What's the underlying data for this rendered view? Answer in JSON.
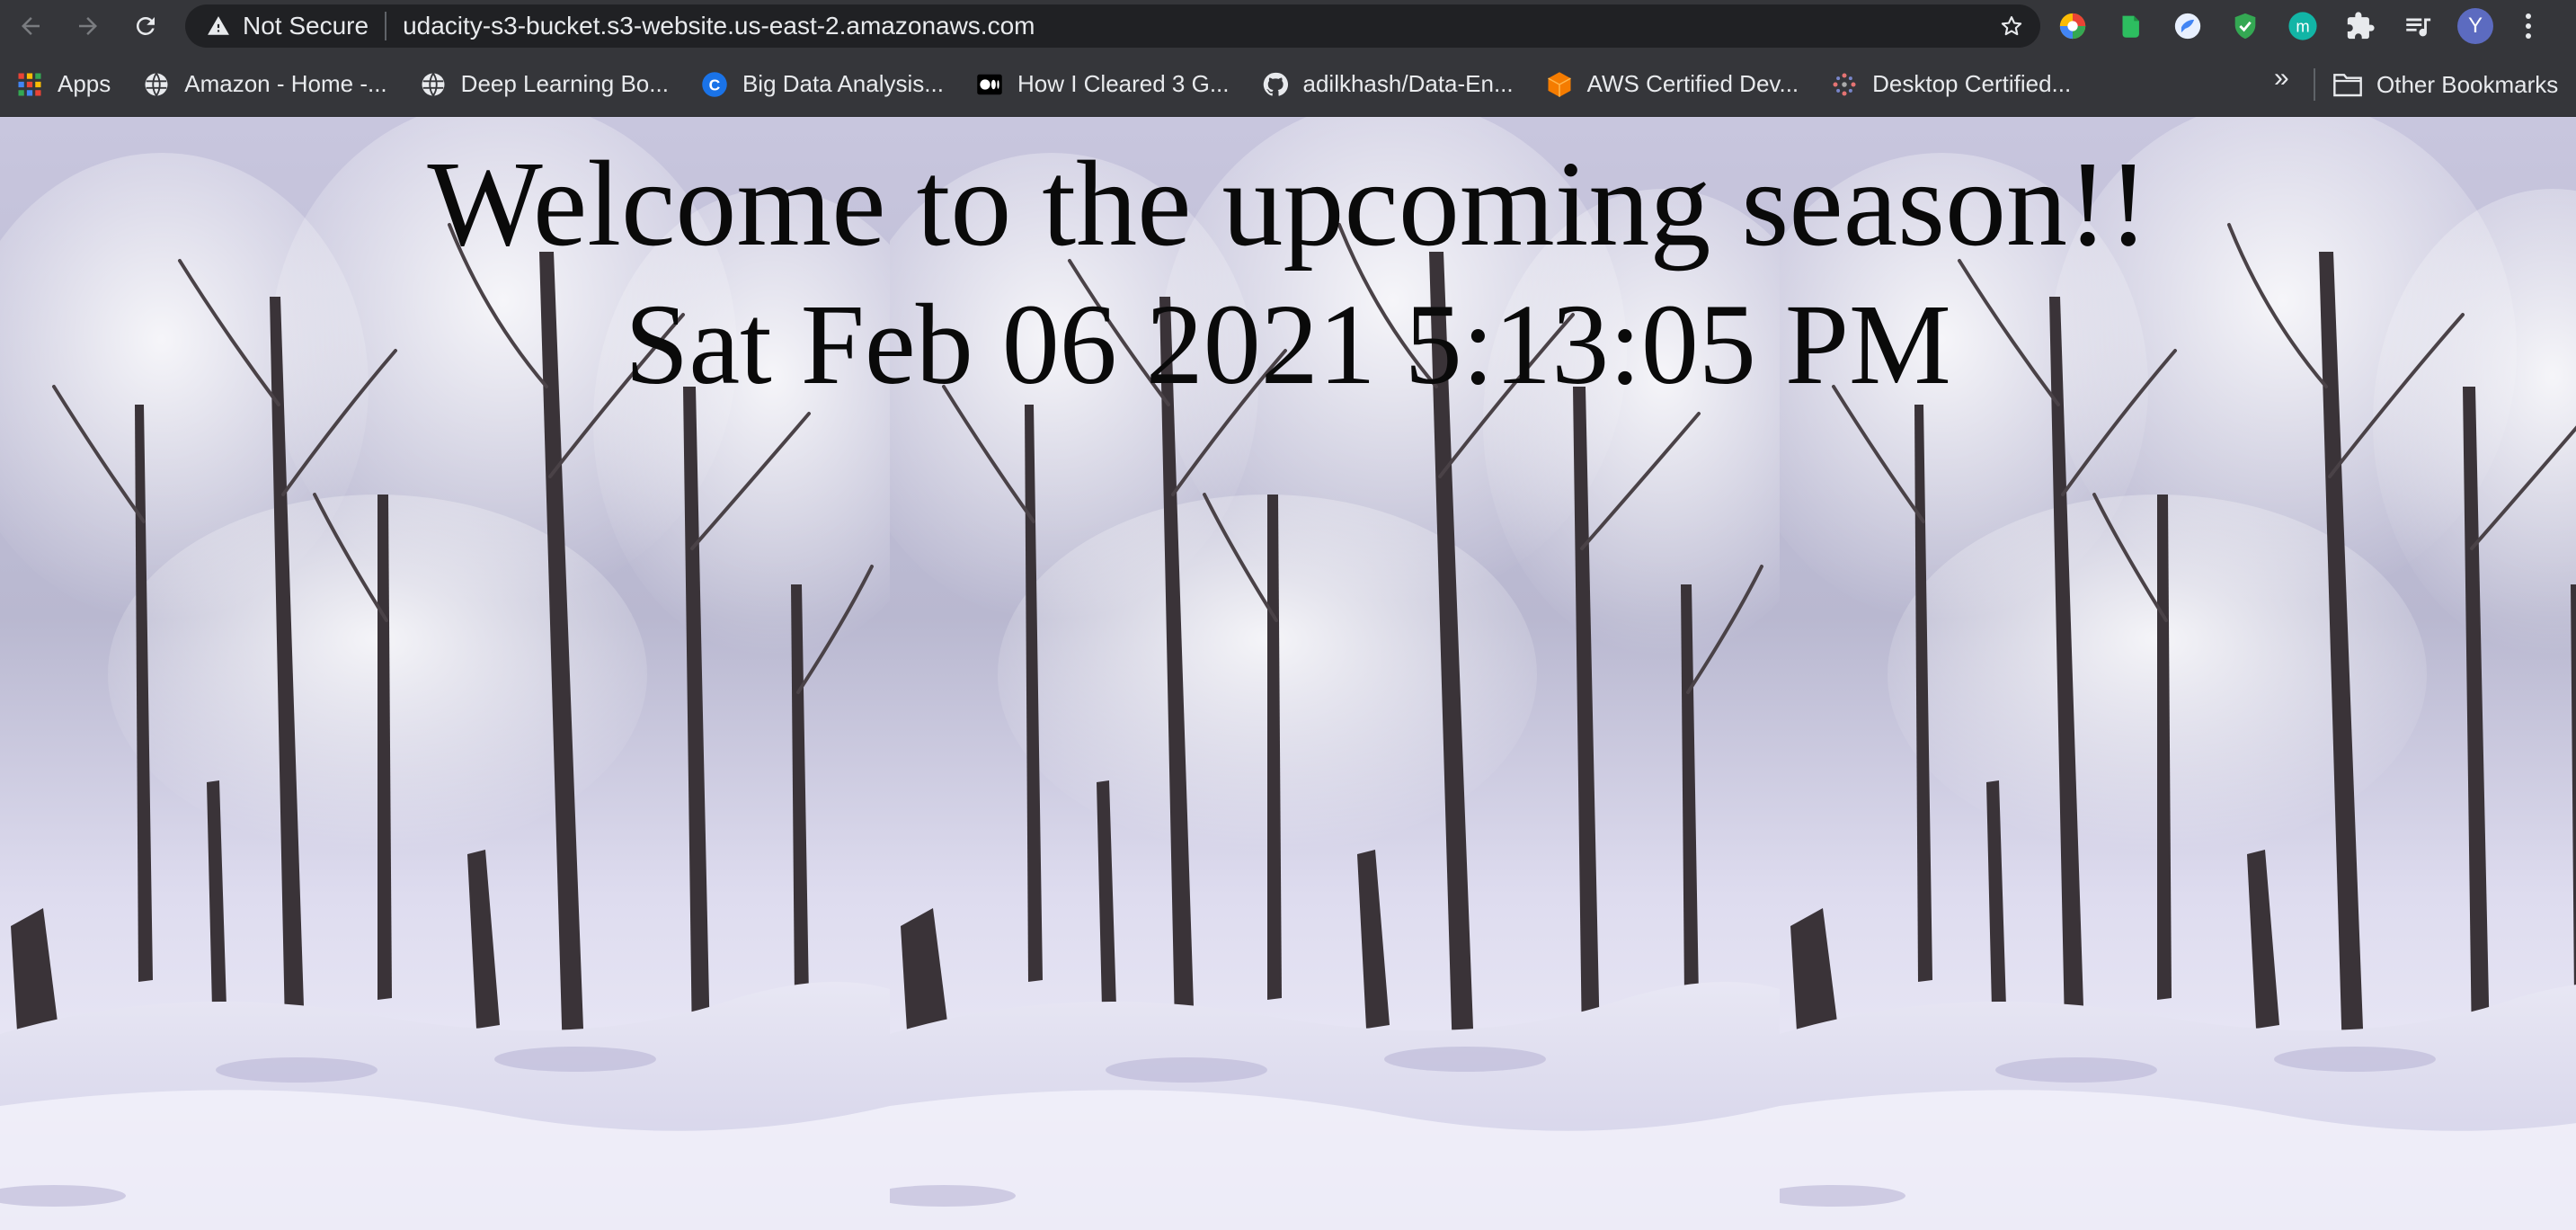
{
  "browser": {
    "security_label": "Not Secure",
    "url": "udacity-s3-bucket.s3-website.us-east-2.amazonaws.com",
    "profile_initial": "Y",
    "extensions": [
      "color-wheel-icon",
      "evernote-icon",
      "bird-extension-icon",
      "shield-check-icon",
      "m-extension-icon",
      "puzzle-icon",
      "media-control-icon"
    ]
  },
  "bookmarks": {
    "items": [
      {
        "label": "Apps",
        "icon": "apps-grid-icon"
      },
      {
        "label": "Amazon - Home -...",
        "icon": "globe-icon"
      },
      {
        "label": "Deep Learning Bo...",
        "icon": "globe-icon"
      },
      {
        "label": "Big Data Analysis...",
        "icon": "c-logo-icon"
      },
      {
        "label": "How I Cleared 3 G...",
        "icon": "medium-logo-icon"
      },
      {
        "label": "adilkhash/Data-En...",
        "icon": "github-icon"
      },
      {
        "label": "AWS Certified Dev...",
        "icon": "cube-icon"
      },
      {
        "label": "Desktop Certified...",
        "icon": "sparkle-icon"
      }
    ],
    "overflow_label": "»",
    "other_label": "Other Bookmarks"
  },
  "page": {
    "headline": "Welcome to the upcoming season!!",
    "datetime": "Sat Feb 06 2021 5:13:05 PM"
  },
  "colors": {
    "toolbar_bg": "#35363a",
    "omnibox_bg": "#202124",
    "text": "#e8eaed",
    "headline": "#0a0a0a"
  }
}
